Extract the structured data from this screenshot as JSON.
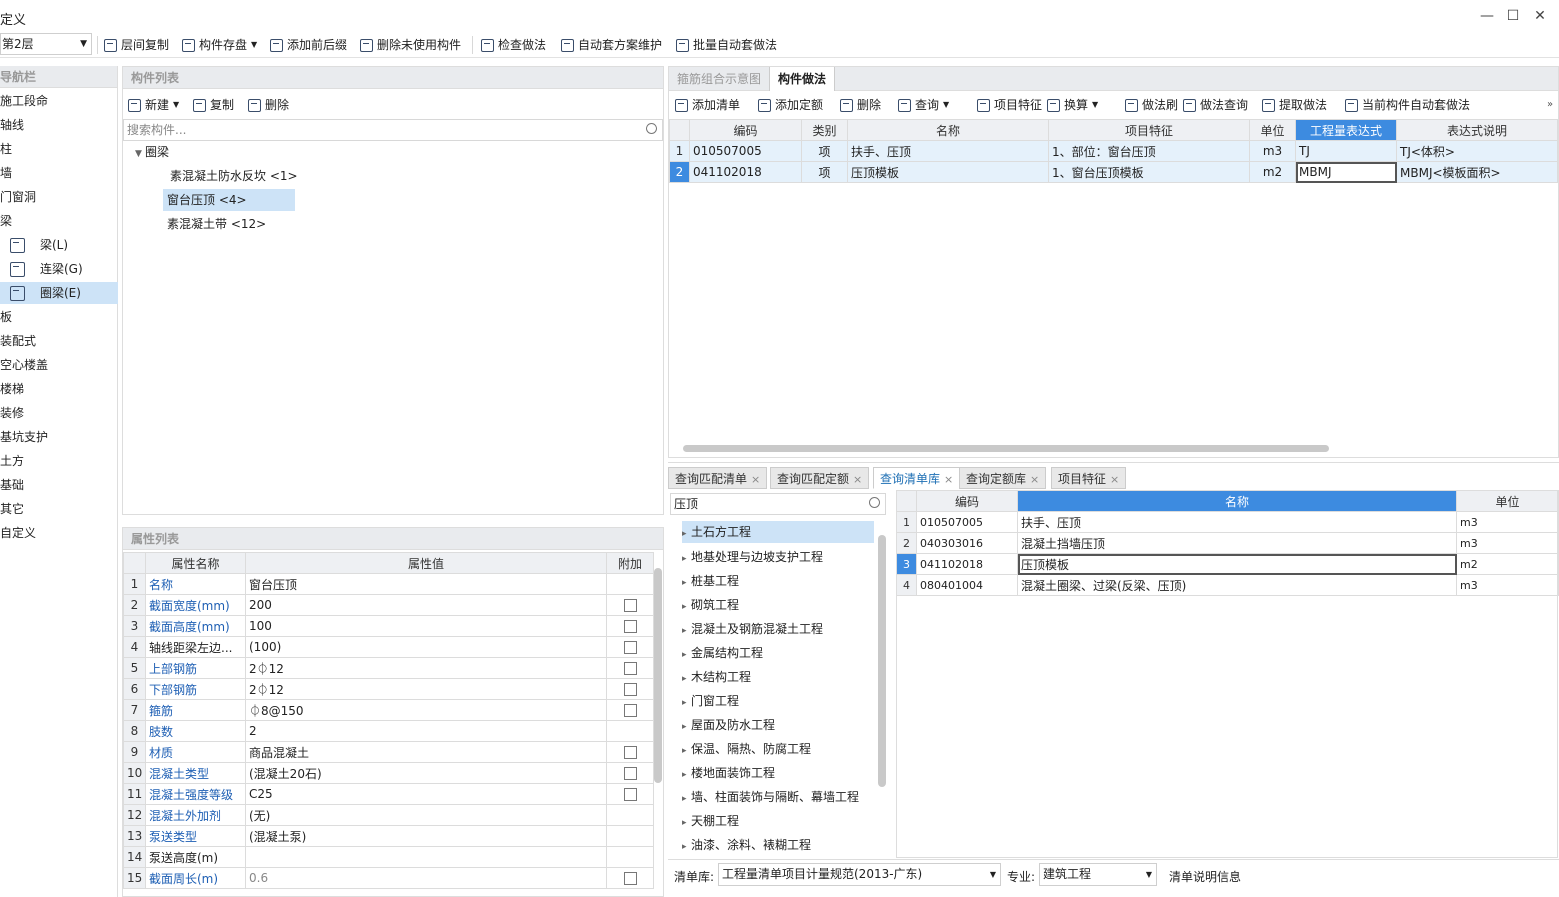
{
  "window": {
    "title": "定义",
    "min": "—",
    "max": "☐",
    "close": "✕"
  },
  "toolbar": {
    "floor": "第2层",
    "items": [
      "层间复制",
      "构件存盘",
      "添加前后缀",
      "删除未使用构件",
      "检查做法",
      "自动套方案维护",
      "批量自动套做法"
    ]
  },
  "nav": {
    "title": "导航栏",
    "items": [
      "施工段命",
      "轴线",
      "柱",
      "墙",
      "门窗洞",
      "梁",
      "梁(L)",
      "连梁(G)",
      "圈梁(E)",
      "板",
      "装配式",
      "空心楼盖",
      "楼梯",
      "装修",
      "基坑支护",
      "土方",
      "基础",
      "其它",
      "自定义"
    ]
  },
  "component_list": {
    "title": "构件列表",
    "new": "新建",
    "copy": "复制",
    "delete": "删除",
    "search_placeholder": "搜索构件...",
    "group": "圈梁",
    "items": [
      "素混凝土防水反坎 <1>",
      "窗台压顶 <4>",
      "素混凝土带 <12>"
    ]
  },
  "property_list": {
    "title": "属性列表",
    "headers": [
      "属性名称",
      "属性值",
      "附加"
    ],
    "rows": [
      {
        "n": "1",
        "name": "名称",
        "value": "窗台压顶",
        "cb": false,
        "blue": true
      },
      {
        "n": "2",
        "name": "截面宽度(mm)",
        "value": "200",
        "cb": true,
        "blue": true
      },
      {
        "n": "3",
        "name": "截面高度(mm)",
        "value": "100",
        "cb": true,
        "blue": true
      },
      {
        "n": "4",
        "name": "轴线距梁左边...",
        "value": "(100)",
        "cb": true,
        "blue": false
      },
      {
        "n": "5",
        "name": "上部钢筋",
        "value": "2⏀12",
        "cb": true,
        "blue": true
      },
      {
        "n": "6",
        "name": "下部钢筋",
        "value": "2⏀12",
        "cb": true,
        "blue": true
      },
      {
        "n": "7",
        "name": "箍筋",
        "value": "⏀8@150",
        "cb": true,
        "blue": true
      },
      {
        "n": "8",
        "name": "肢数",
        "value": "2",
        "cb": false,
        "blue": true
      },
      {
        "n": "9",
        "name": "材质",
        "value": "商品混凝土",
        "cb": true,
        "blue": true
      },
      {
        "n": "10",
        "name": "混凝土类型",
        "value": "(混凝土20石)",
        "cb": true,
        "blue": true
      },
      {
        "n": "11",
        "name": "混凝土强度等级",
        "value": "C25",
        "cb": true,
        "blue": true
      },
      {
        "n": "12",
        "name": "混凝土外加剂",
        "value": "(无)",
        "cb": false,
        "blue": true
      },
      {
        "n": "13",
        "name": "泵送类型",
        "value": "(混凝土泵)",
        "cb": false,
        "blue": true
      },
      {
        "n": "14",
        "name": "泵送高度(m)",
        "value": "",
        "cb": false,
        "blue": false
      },
      {
        "n": "15",
        "name": "截面周长(m)",
        "value": "0.6",
        "cb": true,
        "blue": true
      }
    ]
  },
  "right_tabs": [
    "箍筋组合示意图",
    "构件做法"
  ],
  "method_toolbar": [
    "添加清单",
    "添加定额",
    "删除",
    "查询",
    "项目特征",
    "换算",
    "做法刷",
    "做法查询",
    "提取做法",
    "当前构件自动套做法"
  ],
  "method_table": {
    "headers": [
      "编码",
      "类别",
      "名称",
      "项目特征",
      "单位",
      "工程量表达式",
      "表达式说明"
    ],
    "rows": [
      {
        "n": "1",
        "code": "010507005",
        "type": "项",
        "name": "扶手、压顶",
        "feature": "1、部位：窗台压顶",
        "unit": "m3",
        "expr": "TJ",
        "desc": "TJ<体积>"
      },
      {
        "n": "2",
        "code": "041102018",
        "type": "项",
        "name": "压顶模板",
        "feature": "1、窗台压顶模板",
        "unit": "m2",
        "expr": "MBMJ",
        "desc": "MBMJ<模板面积>"
      }
    ]
  },
  "bottom_tabs": [
    "查询匹配清单",
    "查询匹配定额",
    "查询清单库",
    "查询定额库",
    "项目特征"
  ],
  "query": {
    "search": "压顶",
    "tree": [
      "土石方工程",
      "地基处理与边坡支护工程",
      "桩基工程",
      "砌筑工程",
      "混凝土及钢筋混凝土工程",
      "金属结构工程",
      "木结构工程",
      "门窗工程",
      "屋面及防水工程",
      "保温、隔热、防腐工程",
      "楼地面装饰工程",
      "墙、柱面装饰与隔断、幕墙工程",
      "天棚工程",
      "油漆、涂料、裱糊工程"
    ],
    "headers": [
      "编码",
      "名称",
      "单位"
    ],
    "rows": [
      {
        "n": "1",
        "code": "010507005",
        "name": "扶手、压顶",
        "unit": "m3"
      },
      {
        "n": "2",
        "code": "040303016",
        "name": "混凝土挡墙压顶",
        "unit": "m3"
      },
      {
        "n": "3",
        "code": "041102018",
        "name": "压顶模板",
        "unit": "m2"
      },
      {
        "n": "4",
        "code": "080401004",
        "name": "混凝土圈梁、过梁(反梁、压顶)",
        "unit": "m3"
      }
    ],
    "lib_label": "清单库:",
    "lib_value": "工程量清单项目计量规范(2013-广东)",
    "major_label": "专业:",
    "major_value": "建筑工程",
    "info": "清单说明信息"
  }
}
